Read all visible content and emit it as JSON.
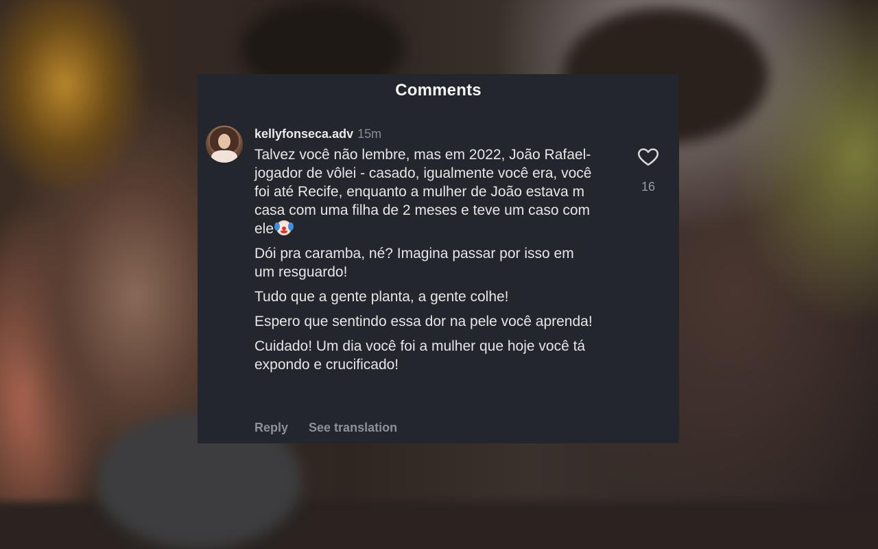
{
  "panel": {
    "title": "Comments"
  },
  "comment": {
    "username": "kellyfonseca.adv",
    "time_ago": "15m",
    "avatar_icon": "profile-photo",
    "paragraphs": [
      "Talvez você não lembre, mas em 2022, João Rafael- jogador de vôlei - casado, igualmente você era, você foi até Recife, enquanto a mulher de João estava m casa com uma filha de 2 meses e teve um caso com ele",
      "Dói pra caramba, né? Imagina passar por isso em um resguardo!",
      "Tudo que a gente planta, a gente colhe!",
      "Espero que sentindo essa dor na pele você aprenda!",
      "Cuidado! Um dia você foi a mulher que hoje você tá expondo e crucificado!"
    ],
    "first_paragraph_emoji": "clown-face",
    "like_icon": "heart-outline-icon",
    "like_count": "16",
    "actions": {
      "reply": "Reply",
      "see_translation": "See translation"
    }
  },
  "colors": {
    "panel_bg": "#24262d",
    "text_primary": "#e6e6e8",
    "text_muted": "#8e9098"
  }
}
